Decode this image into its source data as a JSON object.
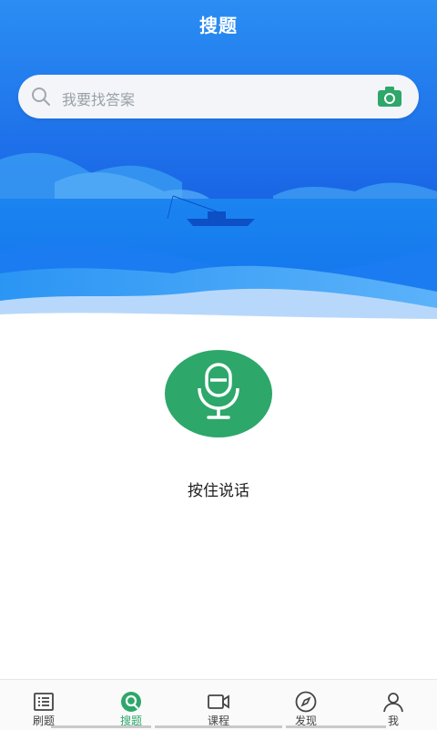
{
  "header": {
    "title": "搜题"
  },
  "search": {
    "placeholder": "我要找答案",
    "icon": "search-icon",
    "camera_icon": "camera-icon"
  },
  "voice": {
    "mic_icon": "microphone-icon",
    "hint": "按住说话"
  },
  "tabbar": {
    "items": [
      {
        "label": "刷题",
        "icon": "list-icon",
        "active": false
      },
      {
        "label": "搜题",
        "icon": "search-bubble-icon",
        "active": true
      },
      {
        "label": "课程",
        "icon": "video-camera-icon",
        "active": false
      },
      {
        "label": "发现",
        "icon": "compass-icon",
        "active": false
      },
      {
        "label": "我",
        "icon": "person-icon",
        "active": false
      }
    ]
  },
  "colors": {
    "accent": "#2ea76a",
    "hero_blue": "#1f6fe8"
  }
}
